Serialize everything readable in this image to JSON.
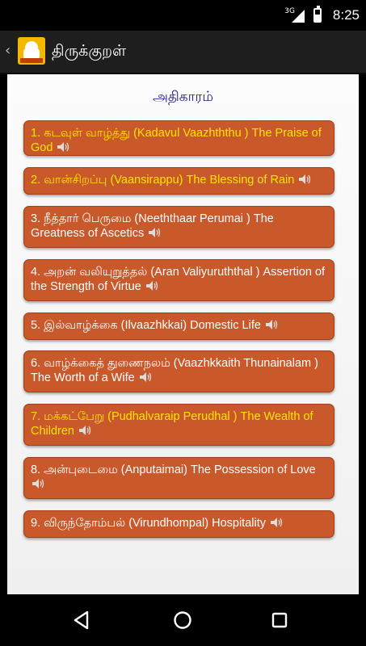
{
  "status_bar": {
    "network": "3G",
    "time": "8:25"
  },
  "app_bar": {
    "title": "திருக்குறள்"
  },
  "section": {
    "heading": "அதிகாரம்"
  },
  "chapters": [
    {
      "label": "1. கடவுள் வாழ்த்து (Kadavul Vaazhththu ) The Praise of God",
      "highlighted": true
    },
    {
      "label": "2. வான்சிறப்பு (Vaansirappu) The Blessing of Rain",
      "highlighted": true
    },
    {
      "label": "3. நீத்தார் பெருமை (Neeththaar Perumai ) The Greatness of Ascetics",
      "highlighted": false
    },
    {
      "label": "4. அறன் வலியுறுத்தல் (Aran Valiyuruththal ) Assertion of the Strength of Virtue",
      "highlighted": false
    },
    {
      "label": "5. இல்வாழ்க்கை (Ilvaazhkkai) Domestic Life",
      "highlighted": false
    },
    {
      "label": "6. வாழ்க்கைத் துணைநலம் (Vaazhkkaith Thunainalam ) The Worth of a Wife",
      "highlighted": false
    },
    {
      "label": "7. மக்கட்பேறு (Pudhalvaraip Perudhal ) The Wealth of Children",
      "highlighted": true
    },
    {
      "label": "8. அன்புடைமை (Anputaimai) The Possession of Love",
      "highlighted": false
    },
    {
      "label": "9. விருந்தோம்பல் (Virundhompal) Hospitality",
      "highlighted": false
    }
  ],
  "colors": {
    "item_bg": "#c9582a",
    "highlight_text": "#ffe600",
    "normal_text": "#ffffff",
    "heading_text": "#1d1a8c"
  },
  "icons": {
    "item_audio": "speaker-icon",
    "nav_back": "back-triangle-icon",
    "nav_home": "home-circle-icon",
    "nav_recents": "recents-square-icon"
  }
}
